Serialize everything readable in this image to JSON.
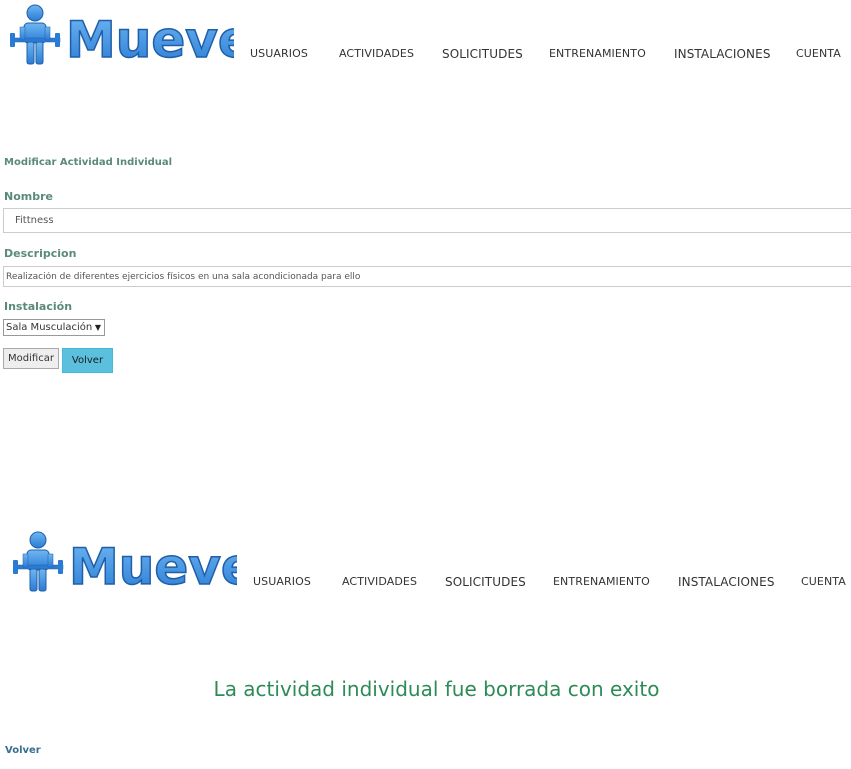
{
  "brand": {
    "name": "MueveT",
    "color": "#3b8ee0"
  },
  "nav": {
    "items": [
      "USUARIOS",
      "ACTIVIDADES",
      "SOLICITUDES",
      "ENTRENAMIENTO",
      "INSTALACIONES",
      "CUENTA"
    ]
  },
  "form": {
    "title": "Modificar Actividad Individual",
    "nombre_label": "Nombre",
    "nombre_value": "Fittness",
    "descripcion_label": "Descripcion",
    "descripcion_value": "Realización de diferentes ejercicios físicos en una sala acondicionada para ello",
    "instalacion_label": "Instalación",
    "instalacion_selected": "Sala Musculación",
    "modificar_label": "Modificar",
    "volver_label": "Volver"
  },
  "result": {
    "message": "La actividad individual fue borrada con exito",
    "volver_link": "Volver",
    "message_color": "#2e8b57"
  }
}
